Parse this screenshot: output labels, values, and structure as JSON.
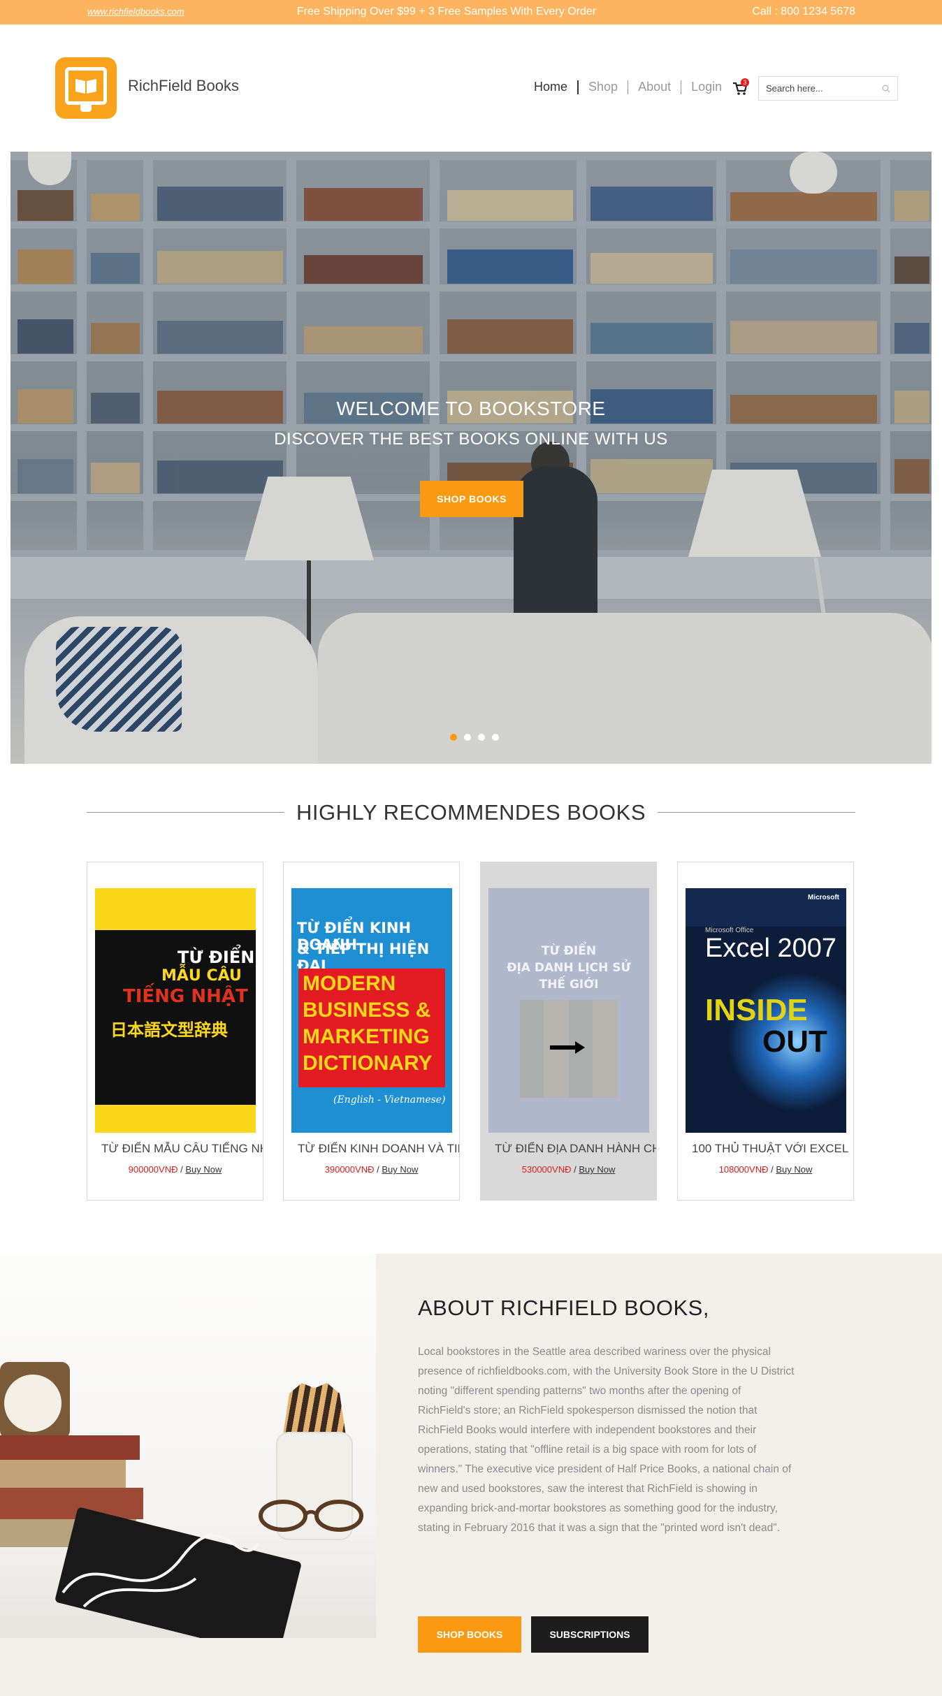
{
  "topbar": {
    "site": "www.richfieldbooks.com",
    "promo": "Free Shipping Over $99 + 3 Free Samples With Every Order",
    "call": "Call : 800 1234 5678"
  },
  "header": {
    "brand": "RichField Books",
    "nav": [
      "Home",
      "Shop",
      "About",
      "Login"
    ],
    "cart_count": "3",
    "search_placeholder": "Search here..."
  },
  "hero": {
    "title": "WELCOME TO BOOKSTORE",
    "subtitle": "DISCOVER THE BEST BOOKS ONLINE WITH US",
    "button": "SHOP BOOKS",
    "active_slide": 1,
    "slides": 4
  },
  "recommended": {
    "title": "HIGHLY RECOMMENDES BOOKS",
    "books": [
      {
        "title": "TỪ ĐIỂN MẪU CÂU TIẾNG NHẬT",
        "price": "900000VNĐ",
        "buy": "Buy Now",
        "cover": {
          "l1": "TỪ ĐIỂN",
          "l2": "MẪU CÂU",
          "l3": "TIẾNG NHẬT",
          "l4": "日本語文型辞典"
        }
      },
      {
        "title": "TỪ ĐIỂN KINH DOANH VÀ TIẾP THỊ HIỆN ĐẠI",
        "price": "390000VNĐ",
        "buy": "Buy Now",
        "cover": {
          "l1": "TỪ ĐIỂN KINH DOANH",
          "l2": "& TIẾP THỊ HIỆN ĐẠI",
          "m1": "MODERN",
          "m2": "BUSINESS &",
          "m3": "MARKETING",
          "m4": "DICTIONARY",
          "sub": "(English - Vietnamese)"
        }
      },
      {
        "title": "TỪ ĐIỂN ĐỊA DANH HÀNH CHÍNH",
        "price": "530000VNĐ",
        "buy": "Buy Now",
        "cover": {
          "l1": "TỪ ĐIỂN",
          "l2": "ĐỊA DANH LỊCH SỬ",
          "l3": "THẾ GIỚI"
        }
      },
      {
        "title": "100 THỦ THUẬT VỚI EXCEL",
        "price": "108000VNĐ",
        "buy": "Buy Now",
        "cover": {
          "brand": "Microsoft",
          "small": "Microsoft Office",
          "title": "Excel 2007",
          "inside": "INSIDE",
          "out": "OUT"
        }
      }
    ]
  },
  "about": {
    "title": "ABOUT RICHFIELD BOOKS,",
    "text": "Local bookstores in the Seattle area described wariness over the physical presence of richfieldbooks.com, with the University Book Store in the U District noting \"different spending patterns\" two months after the opening of RichField's store; an RichField spokesperson dismissed the notion that RichField Books would interfere with independent bookstores and their operations, stating that \"offline retail is a big space with room for lots of winners.\" The executive vice president of Half Price Books, a national chain of new and used bookstores, saw the interest that RichField is showing in expanding brick-and-mortar bookstores as something good for the industry, stating in February 2016 that it was a sign that the \"printed word isn't dead\".",
    "btn_shop": "SHOP BOOKS",
    "btn_sub": "SUBSCRIPTIONS"
  },
  "colors": {
    "accent": "#fa9a12",
    "topbar": "#fdb45f",
    "price": "#e21b1b",
    "dark_button": "#1d1d1d"
  }
}
